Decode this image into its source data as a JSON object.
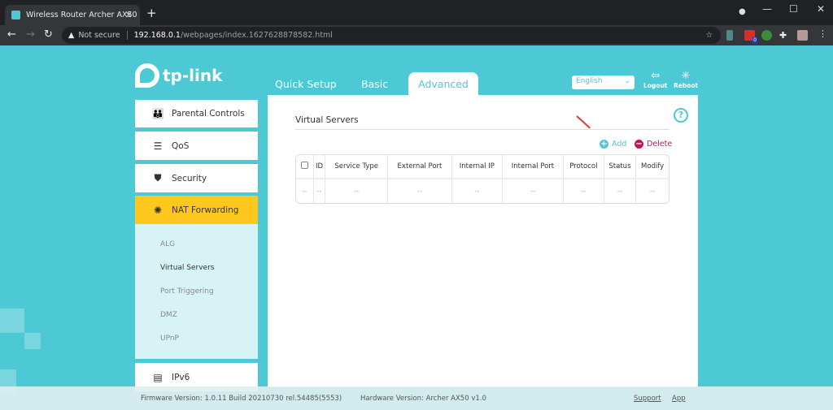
{
  "browser": {
    "tab_title": "Wireless Router Archer AX50",
    "security": "Not secure",
    "url_host": "192.168.0.1",
    "url_path": "/webpages/index.1627628878582.html",
    "ext_badge": "0"
  },
  "header": {
    "logo": "tp-link",
    "tabs": [
      "Quick Setup",
      "Basic",
      "Advanced"
    ],
    "language": "English",
    "logout": "Logout",
    "reboot": "Reboot"
  },
  "sidebar": {
    "items": [
      {
        "label": "Parental Controls",
        "icon": "family-icon"
      },
      {
        "label": "QoS",
        "icon": "qos-icon"
      },
      {
        "label": "Security",
        "icon": "shield-icon"
      },
      {
        "label": "NAT Forwarding",
        "icon": "nat-icon"
      },
      {
        "label": "IPv6",
        "icon": "ipv6-icon"
      }
    ],
    "submenu": [
      "ALG",
      "Virtual Servers",
      "Port Triggering",
      "DMZ",
      "UPnP"
    ]
  },
  "main": {
    "title": "Virtual Servers",
    "add": "Add",
    "delete": "Delete",
    "help": "?",
    "columns": [
      "ID",
      "Service Type",
      "External Port",
      "Internal IP",
      "Internal Port",
      "Protocol",
      "Status",
      "Modify"
    ],
    "row": [
      "--",
      "--",
      "--",
      "--",
      "--",
      "--",
      "--",
      "--",
      "--"
    ]
  },
  "footer": {
    "firmware": "Firmware Version: 1.0.11 Build 20210730 rel.54485(5553)",
    "hardware": "Hardware Version: Archer AX50 v1.0",
    "support": "Support",
    "app": "App"
  },
  "colors": {
    "accent": "#4cc9d5",
    "active": "#ffc81f",
    "delete": "#c2185b"
  }
}
